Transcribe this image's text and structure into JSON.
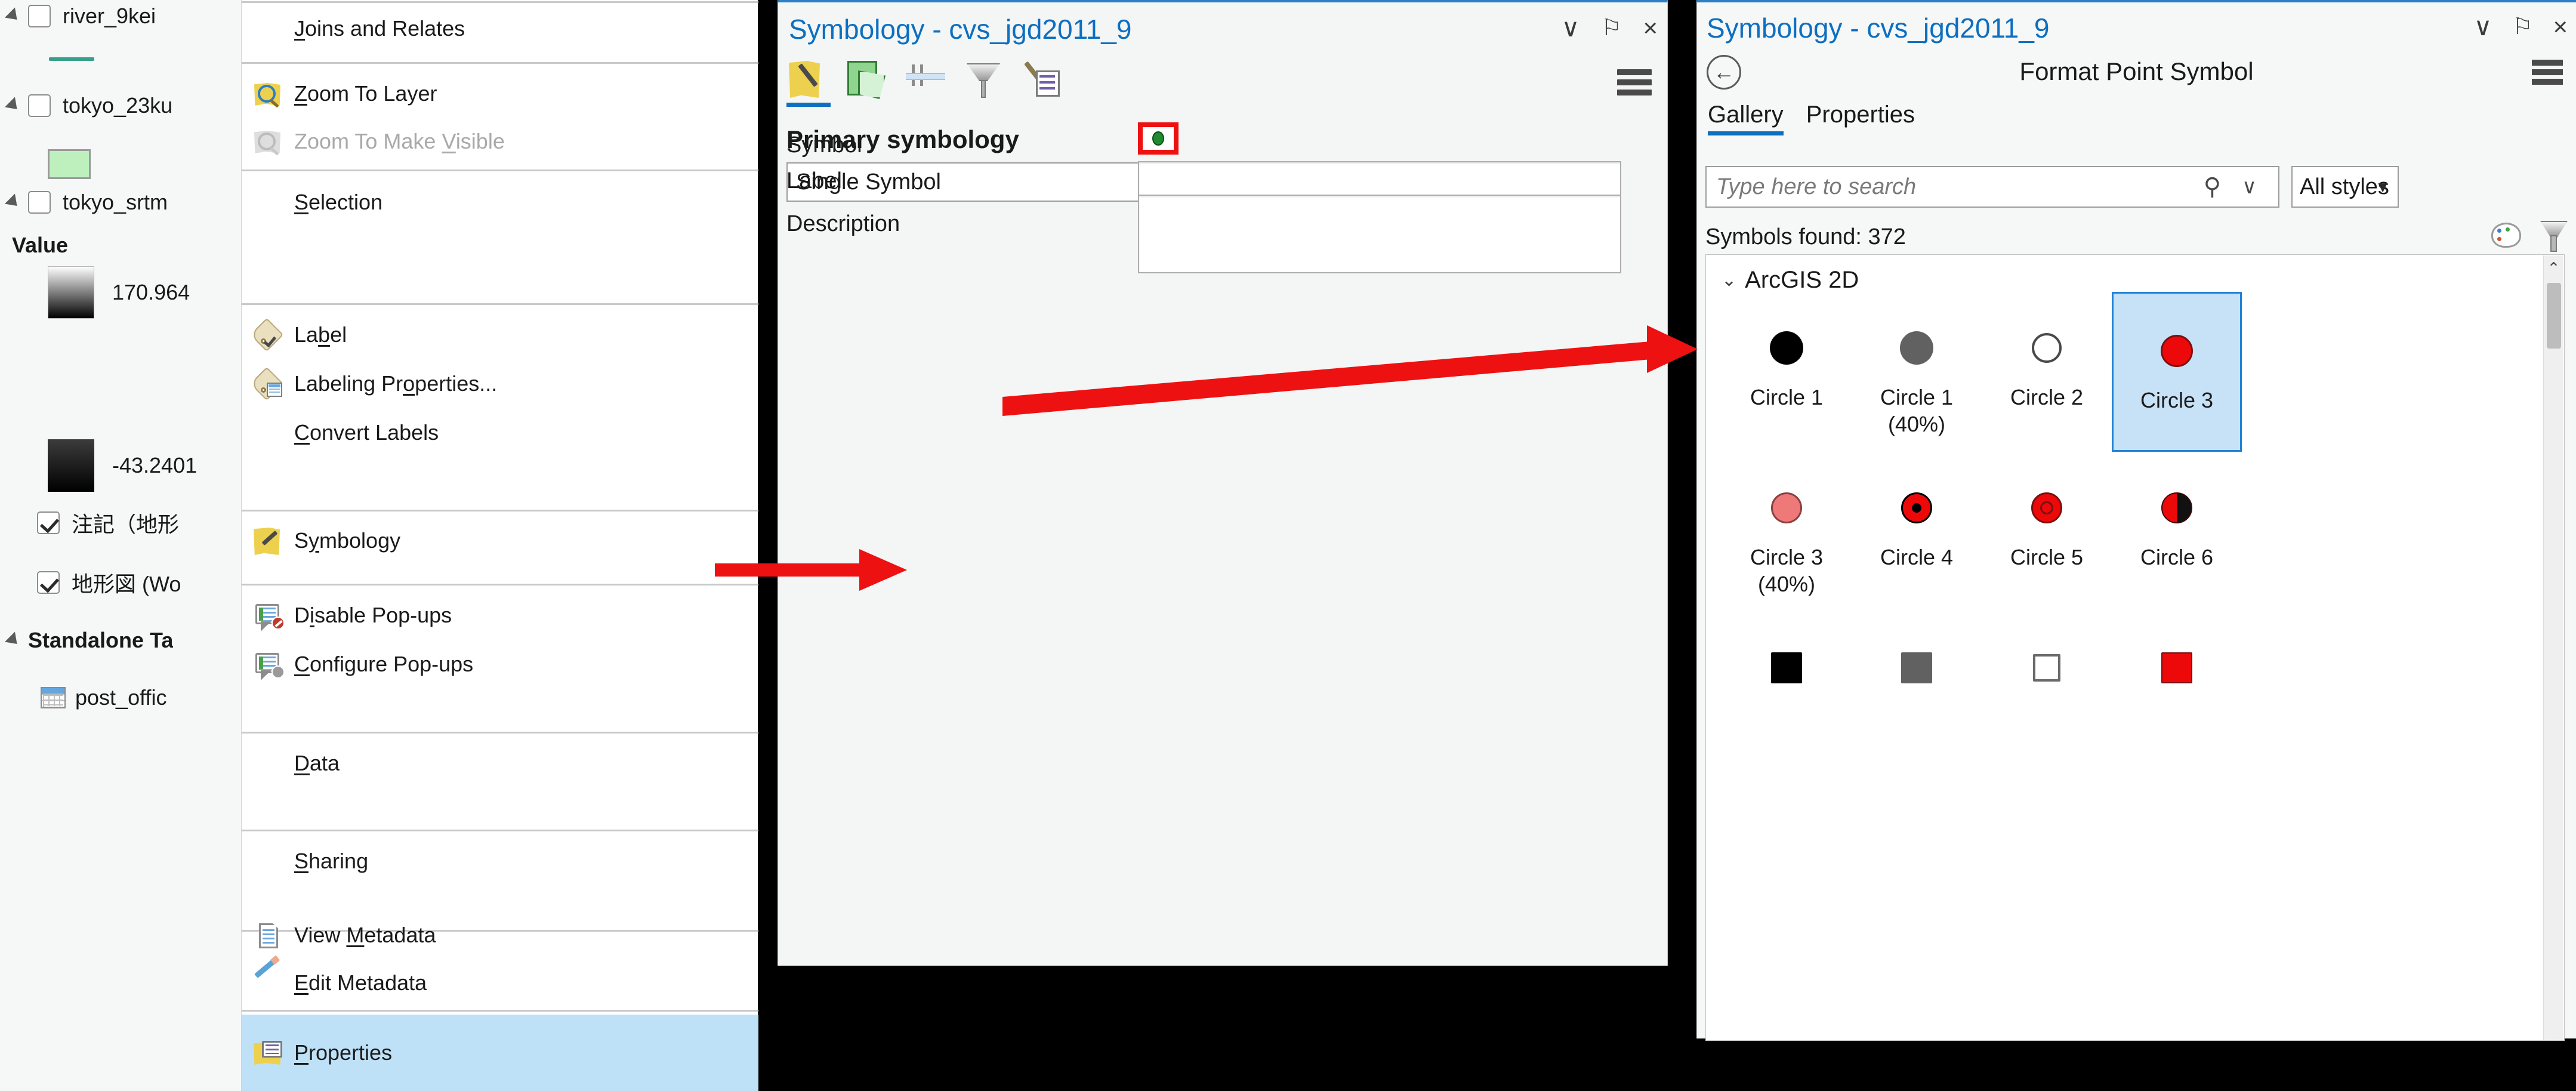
{
  "toc": {
    "items": [
      {
        "label": "river_9kei",
        "type": "layer",
        "checked": false,
        "expander": true
      },
      {
        "label": "tokyo_23ku",
        "type": "layer",
        "checked": false,
        "expander": true
      },
      {
        "label": "tokyo_srtm",
        "type": "layer",
        "checked": false,
        "expander": true
      },
      {
        "label": "Value",
        "type": "legend-header"
      },
      {
        "label": "170.964",
        "type": "legend-value"
      },
      {
        "label": "-43.2401",
        "type": "legend-value"
      },
      {
        "label": "注記（地形",
        "type": "layer",
        "checked": true
      },
      {
        "label": "地形図 (Wo",
        "type": "layer",
        "checked": true
      },
      {
        "label": "Standalone Ta",
        "type": "group",
        "expander": true
      },
      {
        "label": "post_offic",
        "type": "table"
      }
    ]
  },
  "context_menu": {
    "items": [
      {
        "label": "Joins and Relates",
        "icon": "none",
        "disabled": false,
        "highlight": false,
        "accel": "J"
      },
      {
        "label": "Zoom To Layer",
        "icon": "zoom-to-layer-icon",
        "disabled": false,
        "highlight": false,
        "accel": "Z"
      },
      {
        "label": "Zoom To Make Visible",
        "icon": "zoom-to-make-visible-icon",
        "disabled": true,
        "highlight": false,
        "accel": "V"
      },
      {
        "label": "Selection",
        "icon": "none",
        "disabled": false,
        "highlight": false,
        "accel": "S"
      },
      {
        "label": "Label",
        "icon": "label-icon",
        "disabled": false,
        "highlight": false,
        "accel": "b"
      },
      {
        "label": "Labeling Properties...",
        "icon": "labeling-properties-icon",
        "disabled": false,
        "highlight": false,
        "accel": "o"
      },
      {
        "label": "Convert Labels",
        "icon": "none",
        "disabled": false,
        "highlight": false,
        "accel": "C"
      },
      {
        "label": "Symbology",
        "icon": "symbology-icon",
        "disabled": false,
        "highlight": false,
        "accel": "y"
      },
      {
        "label": "Disable Pop-ups",
        "icon": "disable-popups-icon",
        "disabled": false,
        "highlight": false,
        "accel": "i"
      },
      {
        "label": "Configure Pop-ups",
        "icon": "configure-popups-icon",
        "disabled": false,
        "highlight": false,
        "accel": "C"
      },
      {
        "label": "Data",
        "icon": "none",
        "disabled": false,
        "highlight": false,
        "accel": "D"
      },
      {
        "label": "Sharing",
        "icon": "none",
        "disabled": false,
        "highlight": false,
        "accel": "S"
      },
      {
        "label": "View Metadata",
        "icon": "view-metadata-icon",
        "disabled": false,
        "highlight": false,
        "accel": "M"
      },
      {
        "label": "Edit Metadata",
        "icon": "edit-metadata-icon",
        "disabled": false,
        "highlight": false,
        "accel": "E"
      },
      {
        "label": "Properties",
        "icon": "properties-icon",
        "disabled": false,
        "highlight": true,
        "accel": "P"
      }
    ]
  },
  "symbology_pane": {
    "title": "Symbology - cvs_jgd2011_9",
    "controls": {
      "collapse": "∨",
      "pin": "⚐",
      "close": "×"
    },
    "toolbar_tabs": [
      "symbology-tab",
      "vary-by-attribute-tab",
      "grid-tab",
      "masking-tab",
      "alternate-symbols-tab"
    ],
    "menu_icon": "hamburger-menu-icon",
    "section_title": "Primary symbology",
    "symbology_type": "Single Symbol",
    "fields": {
      "symbol_label": "Symbol",
      "symbol_value": "",
      "label_label": "Label",
      "label_value": "",
      "description_label": "Description",
      "description_value": ""
    },
    "highlight_color": "#ee1111"
  },
  "format_pane": {
    "title": "Symbology - cvs_jgd2011_9",
    "subtitle": "Format Point Symbol",
    "back_icon": "back-arrow-icon",
    "menu_icon": "hamburger-menu-icon",
    "controls": {
      "collapse": "∨",
      "pin": "⚐",
      "close": "×"
    },
    "tabs": [
      {
        "label": "Gallery",
        "active": true
      },
      {
        "label": "Properties",
        "active": false
      }
    ],
    "search": {
      "placeholder": "Type here to search",
      "icon": "search-icon",
      "caret": "∨"
    },
    "style_filter": {
      "value": "All styles",
      "caret": "▼"
    },
    "results_text": "Symbols found: 372",
    "toolbar_icons": [
      "palette-icon",
      "filter-icon"
    ],
    "group": {
      "label": "ArcGIS 2D",
      "expanded": true,
      "caret": "⌄"
    },
    "scrollbar": {
      "up_arrow": "⌃"
    },
    "symbols": [
      {
        "name": "Circle 1",
        "shape": "circle",
        "fill": "#000000",
        "stroke": "#000000",
        "selected": false
      },
      {
        "name": "Circle 1\n(40%)",
        "shape": "circle",
        "fill": "#616161",
        "stroke": "#616161",
        "selected": false
      },
      {
        "name": "Circle 2",
        "shape": "circle",
        "fill": "#ffffff",
        "stroke": "#4a4a4a",
        "selected": false
      },
      {
        "name": "Circle 3",
        "shape": "circle",
        "fill": "#ed0909",
        "stroke": "#7a1010",
        "selected": true
      },
      {
        "name": "Circle 3\n(40%)",
        "shape": "circle",
        "fill": "#ef7878",
        "stroke": "#8a4040",
        "selected": false
      },
      {
        "name": "Circle 4",
        "shape": "circle-dot",
        "fill": "#ed0909",
        "stroke": "#000000",
        "selected": false
      },
      {
        "name": "Circle 5",
        "shape": "circle-ring",
        "fill": "#ed0909",
        "stroke": "#7a1010",
        "selected": false
      },
      {
        "name": "Circle 6",
        "shape": "circle-half",
        "fill": "#ed0909",
        "stroke": "#000000",
        "selected": false
      },
      {
        "name": "",
        "shape": "square",
        "fill": "#000000",
        "stroke": "#000000",
        "selected": false
      },
      {
        "name": "",
        "shape": "square",
        "fill": "#616161",
        "stroke": "#616161",
        "selected": false
      },
      {
        "name": "",
        "shape": "square",
        "fill": "#ffffff",
        "stroke": "#6a6a6a",
        "selected": false
      },
      {
        "name": "",
        "shape": "square",
        "fill": "#ed0909",
        "stroke": "#7a1010",
        "selected": false
      }
    ]
  }
}
